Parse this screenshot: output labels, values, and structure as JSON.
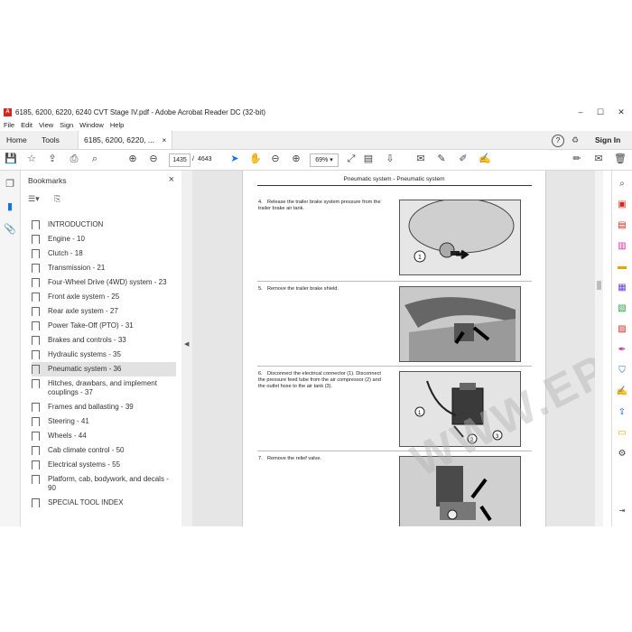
{
  "titlebar": {
    "title": "6185, 6200, 6220, 6240 CVT Stage IV.pdf - Adobe Acrobat Reader DC (32-bit)",
    "minimize": "–",
    "maximize": "☐",
    "close": "✕"
  },
  "menubar": {
    "items": [
      "File",
      "Edit",
      "View",
      "Sign",
      "Window",
      "Help"
    ]
  },
  "tabs": {
    "home": "Home",
    "tools": "Tools",
    "document": "6185, 6200, 6220, ...",
    "doc_close": "×",
    "help_icon": "?",
    "bell_icon": "🔔",
    "sign_in": "Sign In"
  },
  "toolbar": {
    "current_page": "1435",
    "page_sep": "/",
    "total_pages": "4643",
    "zoom": "69%"
  },
  "bookmarks": {
    "title": "Bookmarks",
    "close": "×",
    "items": [
      "INTRODUCTION",
      "Engine - 10",
      "Clutch - 18",
      "Transmission - 21",
      "Four-Wheel Drive (4WD) system - 23",
      "Front axle system - 25",
      "Rear axle system - 27",
      "Power Take-Off (PTO) - 31",
      "Brakes and controls - 33",
      "Hydraulic systems - 35",
      "Pneumatic system - 36",
      "Hitches, drawbars, and implement couplings - 37",
      "Frames and ballasting - 39",
      "Steering - 41",
      "Wheels - 44",
      "Cab climate control - 50",
      "Electrical systems - 55",
      "Platform, cab, bodywork, and decals - 90",
      "SPECIAL TOOL INDEX"
    ],
    "selected_index": 10
  },
  "page": {
    "header": "Pneumatic system - Pneumatic system",
    "steps": [
      {
        "num": "4.",
        "text": "Release the trailer brake system pressure from the trailer brake air tank."
      },
      {
        "num": "5.",
        "text": "Remove the trailer brake shield."
      },
      {
        "num": "6.",
        "text": "Disconnect the electrical connector (1). Disconnect the pressure feed tube from the air compressor (2) and the outlet hose to the air tank (3)."
      },
      {
        "num": "7.",
        "text": "Remove the relief valve."
      }
    ],
    "fig_labels": [
      "1",
      "1",
      "2",
      "3"
    ]
  },
  "watermark": "WWW.EPCDERO.COM",
  "colors": {
    "accent": "#1473e6",
    "pdf_red": "#d7261c",
    "selection": "#e2e2e2"
  },
  "icons": {
    "left": [
      "thumbnails-icon",
      "bookmark-icon",
      "attachment-icon"
    ],
    "right": [
      "search-icon",
      "export-pdf-icon",
      "create-pdf-icon",
      "edit-pdf-icon",
      "comment-icon",
      "combine-files-icon",
      "organize-pages-icon",
      "compress-icon",
      "fill-sign-icon",
      "protect-icon",
      "send-for-signature-icon",
      "share-icon",
      "scan-icon",
      "more-tools-icon"
    ]
  }
}
